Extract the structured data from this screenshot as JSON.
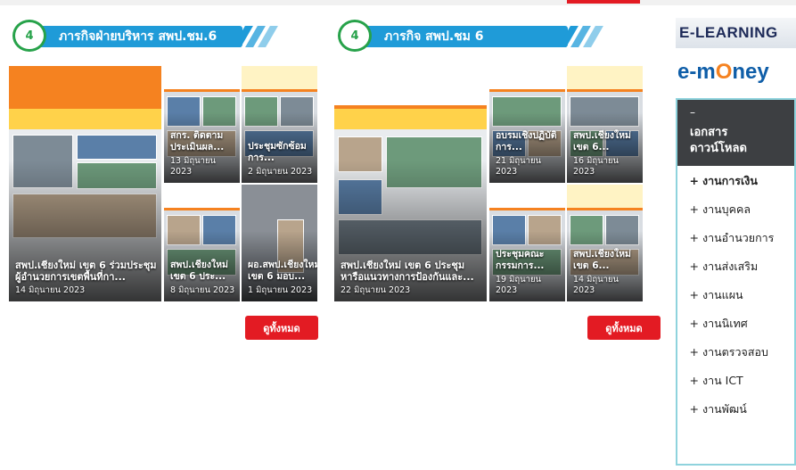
{
  "sections": [
    {
      "title": "ภารกิจฝ่ายบริหาร สพป.ชม.6",
      "logo_text": "4",
      "big": {
        "title": "สพป.เชียงใหม่ เขต 6 ร่วมประชุมผู้อำนวยการเขตพื้นที่กา...",
        "date": "14 มิถุนายน 2023"
      },
      "small": [
        {
          "title": "สกร. ติดตามประเมินผล...",
          "date": "13 มิถุนายน 2023"
        },
        {
          "title": "ประชุมซักซ้อมการ...",
          "date": "2 มิถุนายน 2023"
        },
        {
          "title": "สพป.เชียงใหม่ เขต 6 ประ...",
          "date": "8 มิถุนายน 2023"
        },
        {
          "title": "ผอ.สพป.เชียงใหม่ เขต 6 มอบ...",
          "date": "1 มิถุนายน 2023"
        }
      ],
      "more_label": "ดูทั้งหมด"
    },
    {
      "title": "ภารกิจ สพป.ชม 6",
      "logo_text": "4",
      "big": {
        "title": "สพป.เชียงใหม่ เขต 6 ประชุมหารือแนวทางการป้องกันและ...",
        "date": "22 มิถุนายน 2023"
      },
      "small": [
        {
          "title": "อบรมเชิงปฏิบัติการ...",
          "date": "21 มิถุนายน 2023"
        },
        {
          "title": "สพป.เชียงใหม่ เขต 6...",
          "date": "16 มิถุนายน 2023"
        },
        {
          "title": "ประชุมคณะกรรมการ...",
          "date": "19 มิถุนายน 2023"
        },
        {
          "title": "สพป.เชียงใหม่ เขต 6...",
          "date": "14 มิถุนายน 2023"
        }
      ],
      "more_label": "ดูทั้งหมด"
    }
  ],
  "sidebar": {
    "elearning_label": "E-LEARNING",
    "emoney_prefix": "e-m",
    "emoney_o": "O",
    "emoney_suffix": "ney",
    "download": {
      "dash": "–",
      "title_line1": "เอกสาร",
      "title_line2": "ดาวน์โหลด",
      "bullet": "+",
      "items": [
        {
          "label": "งานการเงิน",
          "bold": true
        },
        {
          "label": "งานบุคคล",
          "bold": false
        },
        {
          "label": "งานอำนวยการ",
          "bold": false
        },
        {
          "label": "งานส่งเสริม",
          "bold": false
        },
        {
          "label": "งานแผน",
          "bold": false
        },
        {
          "label": "งานนิเทศ",
          "bold": false
        },
        {
          "label": "งานตรวจสอบ",
          "bold": false
        },
        {
          "label": "งาน ICT",
          "bold": false
        },
        {
          "label": "งานพัฒน์",
          "bold": false
        }
      ]
    }
  },
  "colors": {
    "accent_blue": "#1f9bd8",
    "accent_red": "#e31b23",
    "accent_orange": "#f58220",
    "panel_dark": "#3d3f42",
    "panel_border": "#8fd3dd"
  }
}
